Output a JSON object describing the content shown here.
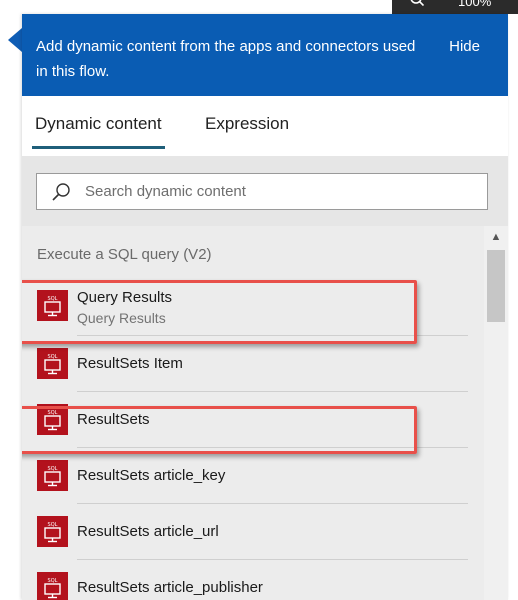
{
  "top_strip": {
    "zoom_text": "100%"
  },
  "panel": {
    "header_text": "Add dynamic content from the apps and connectors used in this flow.",
    "hide_label": "Hide",
    "tabs": [
      {
        "label": "Dynamic content",
        "active": true
      },
      {
        "label": "Expression",
        "active": false
      }
    ],
    "search": {
      "placeholder": "Search dynamic content",
      "value": ""
    },
    "section_header": "Execute a SQL query (V2)",
    "items": [
      {
        "title": "Query Results",
        "subtitle": "Query Results",
        "icon": "sql-icon",
        "highlighted": true
      },
      {
        "title": "ResultSets Item",
        "icon": "sql-icon",
        "highlighted": false
      },
      {
        "title": "ResultSets",
        "icon": "sql-icon",
        "highlighted": true
      },
      {
        "title": "ResultSets article_key",
        "icon": "sql-icon",
        "highlighted": false
      },
      {
        "title": "ResultSets article_url",
        "icon": "sql-icon",
        "highlighted": false
      },
      {
        "title": "ResultSets article_publisher",
        "icon": "sql-icon",
        "highlighted": false
      }
    ]
  },
  "colors": {
    "header_bg": "#0a5cb3",
    "icon_bg": "#b3121d",
    "highlight": "#e8504a",
    "tab_underline": "#1f5f7a"
  }
}
